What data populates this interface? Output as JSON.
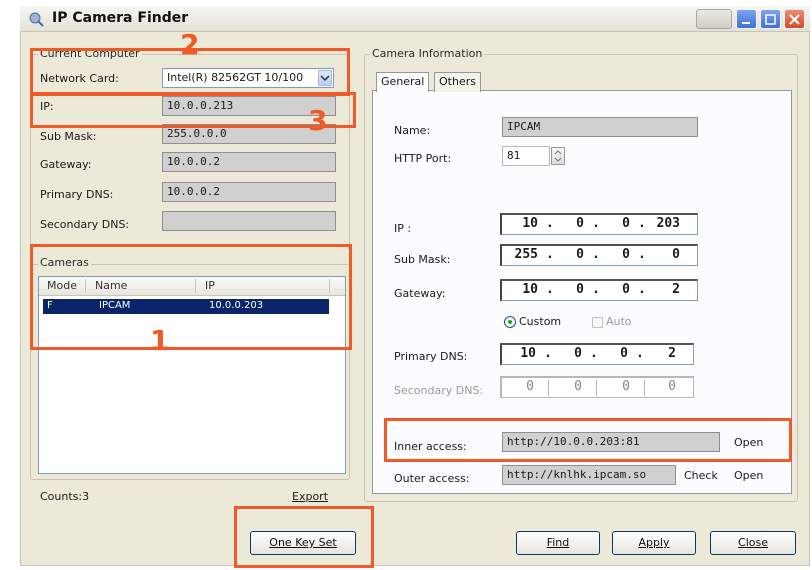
{
  "window": {
    "title": "IP Camera Finder"
  },
  "computer": {
    "group_label": "Current Computer",
    "network_card_label": "Network Card:",
    "network_card_value": "Intel(R) 82562GT 10/100",
    "ip_label": "IP:",
    "ip_value": "10.0.0.213",
    "submask_label": "Sub Mask:",
    "submask_value": "255.0.0.0",
    "gateway_label": "Gateway:",
    "gateway_value": "10.0.0.2",
    "primary_dns_label": "Primary DNS:",
    "primary_dns_value": "10.0.0.2",
    "secondary_dns_label": "Secondary DNS:",
    "secondary_dns_value": ""
  },
  "cameras": {
    "group_label": "Cameras",
    "columns": [
      "Mode",
      "Name",
      "IP"
    ],
    "rows": [
      {
        "mode": "F",
        "name": "IPCAM",
        "ip": "10.0.0.203"
      }
    ],
    "counts_label": "Counts:3",
    "export_label": "Export",
    "one_key_set_label": "One Key Set"
  },
  "camera_info": {
    "group_label": "Camera Information",
    "tabs": [
      "General",
      "Others"
    ],
    "name_label": "Name:",
    "name_value": "IPCAM",
    "http_port_label": "HTTP Port:",
    "http_port_value": "81",
    "ip_label": "IP :",
    "ip_octets": [
      "10",
      "0",
      "0",
      "203"
    ],
    "submask_label": "Sub Mask:",
    "submask_octets": [
      "255",
      "0",
      "0",
      "0"
    ],
    "gateway_label": "Gateway:",
    "gateway_octets": [
      "10",
      "0",
      "0",
      "2"
    ],
    "custom_label": "Custom",
    "auto_label": "Auto",
    "primary_dns_label": "Primary DNS:",
    "primary_dns_octets": [
      "10",
      "0",
      "0",
      "2"
    ],
    "secondary_dns_label": "Secondary DNS:",
    "secondary_dns_octets": [
      "0",
      "0",
      "0",
      "0"
    ],
    "inner_access_label": "Inner access:",
    "inner_access_value": "http://10.0.0.203:81",
    "outer_access_label": "Outer access:",
    "outer_access_value": "http://knlhk.ipcam.so",
    "open_label": "Open",
    "check_label": "Check"
  },
  "buttons": {
    "find": "Find",
    "apply": "Apply",
    "close": "Close"
  },
  "annotations": [
    "1",
    "2",
    "3"
  ],
  "colors": {
    "annotation": "#f05a28",
    "selection": "#0a246a",
    "window_bg": "#ece9d8"
  }
}
